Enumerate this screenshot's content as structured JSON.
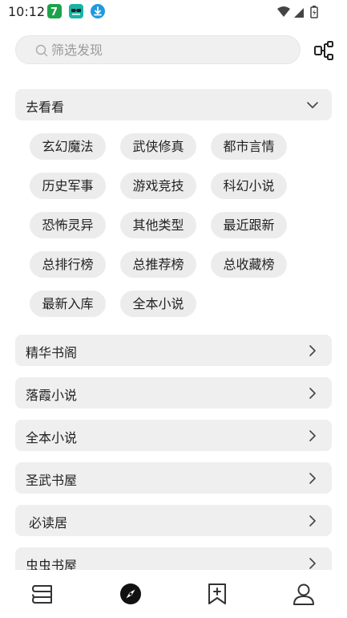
{
  "status": {
    "time": "10:12"
  },
  "search": {
    "placeholder": "筛选发现"
  },
  "go_look": {
    "label": "去看看",
    "tags": [
      "玄幻魔法",
      "武侠修真",
      "都市言情",
      "历史军事",
      "游戏竞技",
      "科幻小说",
      "恐怖灵异",
      "其他类型",
      "最近跟新",
      "总排行榜",
      "总推荐榜",
      "总收藏榜",
      "最新入库",
      "全本小说"
    ]
  },
  "sources": [
    {
      "label": "精华书阁"
    },
    {
      "label": "落霞小说"
    },
    {
      "label": "全本小说"
    },
    {
      "label": "圣武书屋"
    },
    {
      "label": "必读居"
    },
    {
      "label": "虫虫书屋"
    }
  ],
  "bottom_nav": {
    "items": [
      {
        "icon": "bookshelf-icon"
      },
      {
        "icon": "discover-compass-icon"
      },
      {
        "icon": "bookmark-add-icon"
      },
      {
        "icon": "profile-icon"
      }
    ]
  },
  "colors": {
    "accent_green": "#1aa34a",
    "accent_teal": "#19b3a6",
    "accent_blue": "#1f9ae0",
    "section_bg": "#efefef",
    "tag_bg": "#ececec"
  }
}
